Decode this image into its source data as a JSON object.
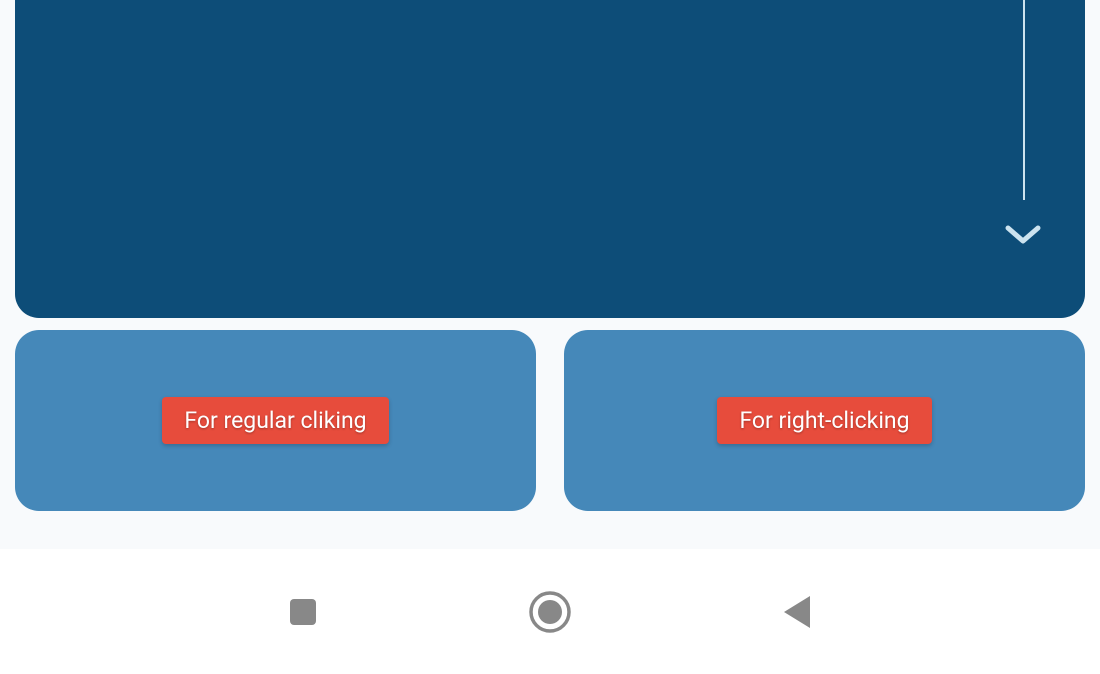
{
  "trackpad": {
    "scroll_direction": "down"
  },
  "buttons": {
    "left": {
      "label": "For regular cliking"
    },
    "right": {
      "label": "For right-clicking"
    }
  },
  "nav": {
    "recent": "recent-apps",
    "home": "home",
    "back": "back"
  },
  "colors": {
    "trackpad_bg": "#0d4d78",
    "button_bg": "#4588b9",
    "label_bg": "#e74c3c",
    "nav_icon": "#888888"
  }
}
